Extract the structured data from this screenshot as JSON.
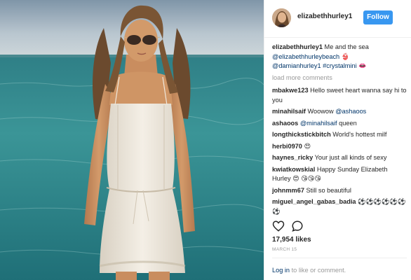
{
  "post": {
    "username": "elizabethhurley1",
    "follow_label": "Follow",
    "caption": {
      "username": "elizabethhurley1",
      "text": " Me and the sea ",
      "mention1": "@elizabethhurleybeach",
      "emoji1": " 👙",
      "mention2": "@damianhurley1",
      "hashtag": " #crystalmini",
      "emoji2": " 👄"
    },
    "load_more": "load more comments",
    "comments": [
      {
        "user": "mbakwe123",
        "text": " Hello sweet heart wanna say hi to you",
        "mention": ""
      },
      {
        "user": "minahilsaif",
        "text": " Woowow ",
        "mention": "@ashaoos"
      },
      {
        "user": "ashaoos",
        "text": " queen",
        "mention": " @minahilsaif"
      },
      {
        "user": "longthickstickbitch",
        "text": " World's hottest milf",
        "mention": ""
      },
      {
        "user": "herbi0970",
        "text": " 😍",
        "mention": ""
      },
      {
        "user": "haynes_ricky",
        "text": " Your just all kinds of sexy",
        "mention": ""
      },
      {
        "user": "kwiatkowskial",
        "text": " Happy Sunday Elizabeth Hurley 😍 😘😘😘",
        "mention": ""
      },
      {
        "user": "johnmm67",
        "text": " Still so beautiful",
        "mention": ""
      },
      {
        "user": "miguel_angel_gabas_badia",
        "text": " ⚽⚽⚽⚽⚽⚽⚽",
        "mention": ""
      }
    ],
    "likes": "17,954 likes",
    "date": "MARCH 15",
    "login": {
      "link": "Log in",
      "rest": " to like or comment."
    }
  },
  "icons": {
    "like": "heart-icon",
    "comment": "comment-bubble-icon"
  },
  "colors": {
    "follow_button": "#3897f0",
    "link": "#003569",
    "muted": "#999999",
    "sea": "#3e8f91",
    "sky": "#9fb8c4"
  }
}
